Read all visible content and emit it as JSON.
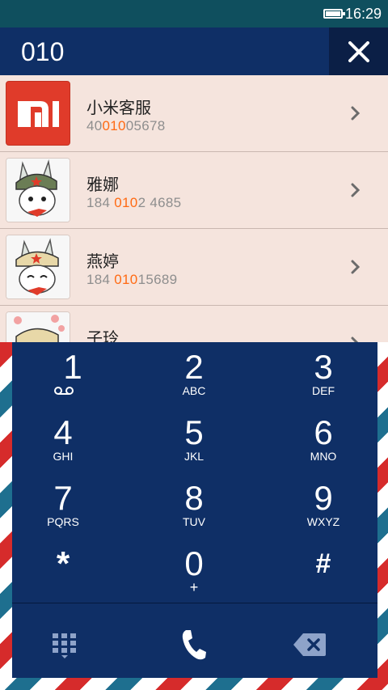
{
  "status_bar": {
    "time": "16:29",
    "battery_level": 1.0
  },
  "search": {
    "query": "010",
    "clear_icon": "close-icon"
  },
  "contacts": [
    {
      "name": "小米客服",
      "number_parts": [
        "40",
        "010",
        "05678"
      ],
      "avatar": "mi-logo"
    },
    {
      "name": "雅娜",
      "number_parts": [
        "184 ",
        "010",
        "2 4685"
      ],
      "avatar": "bunny-avatar"
    },
    {
      "name": "燕婷",
      "number_parts": [
        "184 ",
        "010",
        "15689"
      ],
      "avatar": "bunny-avatar"
    },
    {
      "name": "子玲",
      "number_parts": [
        "",
        "",
        ""
      ],
      "avatar": "bunny-avatar"
    }
  ],
  "keypad": {
    "keys": [
      {
        "digit": "1",
        "letters": ""
      },
      {
        "digit": "2",
        "letters": "ABC"
      },
      {
        "digit": "3",
        "letters": "DEF"
      },
      {
        "digit": "4",
        "letters": "GHI"
      },
      {
        "digit": "5",
        "letters": "JKL"
      },
      {
        "digit": "6",
        "letters": "MNO"
      },
      {
        "digit": "7",
        "letters": "PQRS"
      },
      {
        "digit": "8",
        "letters": "TUV"
      },
      {
        "digit": "9",
        "letters": "WXYZ"
      },
      {
        "digit": "*",
        "letters": ""
      },
      {
        "digit": "0",
        "letters": "+"
      },
      {
        "digit": "#",
        "letters": ""
      }
    ]
  },
  "actions": {
    "left": "dialpad-toggle-icon",
    "center": "phone-call-icon",
    "right": "backspace-icon"
  },
  "colors": {
    "highlight": "#ff6a13",
    "keypad_bg": "#0f2f66",
    "list_bg": "#f5e4dd",
    "mi_red": "#e03b2a"
  }
}
